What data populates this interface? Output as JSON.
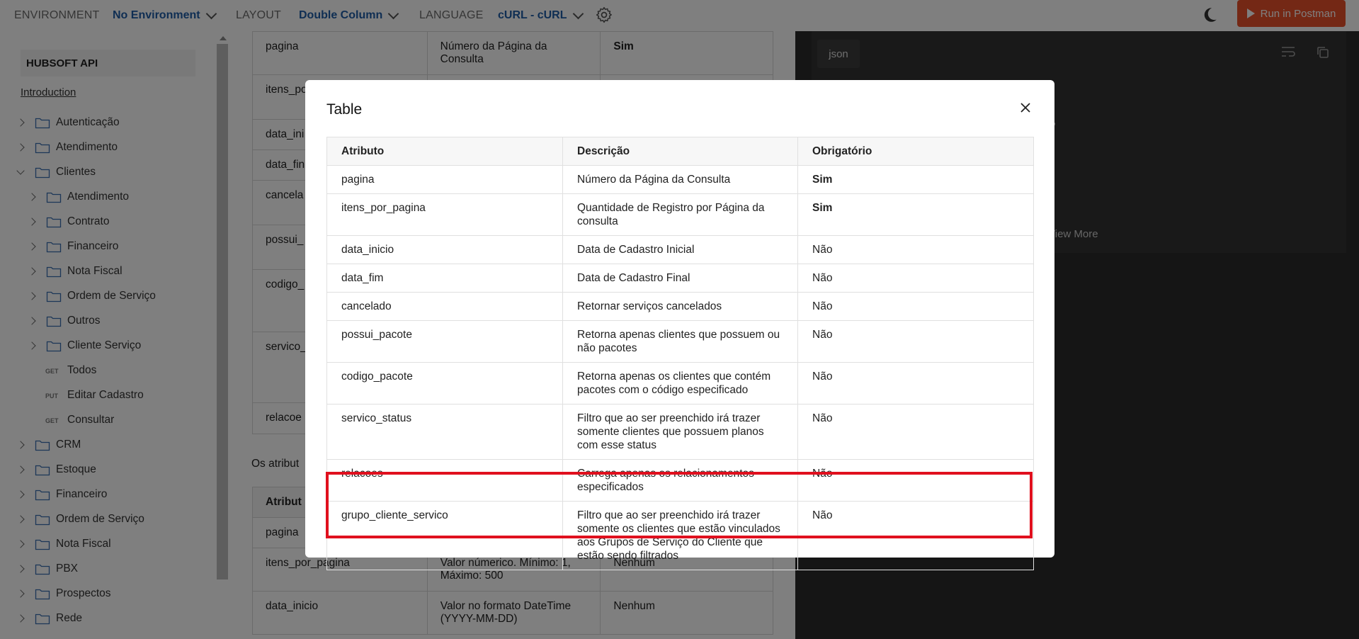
{
  "topbar": {
    "environment_label": "ENVIRONMENT",
    "environment_value": "No Environment",
    "layout_label": "LAYOUT",
    "layout_value": "Double Column",
    "language_label": "LANGUAGE",
    "language_value": "cURL - cURL",
    "run_button": "Run in Postman",
    "accent_color": "#e8502a"
  },
  "sidebar": {
    "title": "HUBSOFT API",
    "intro": "Introduction",
    "items": [
      {
        "label": "Autenticação",
        "type": "folder",
        "level": 0,
        "expanded": false
      },
      {
        "label": "Atendimento",
        "type": "folder",
        "level": 0,
        "expanded": false
      },
      {
        "label": "Clientes",
        "type": "folder",
        "level": 0,
        "expanded": true
      },
      {
        "label": "Atendimento",
        "type": "folder",
        "level": 1,
        "expanded": false
      },
      {
        "label": "Contrato",
        "type": "folder",
        "level": 1,
        "expanded": false
      },
      {
        "label": "Financeiro",
        "type": "folder",
        "level": 1,
        "expanded": false
      },
      {
        "label": "Nota Fiscal",
        "type": "folder",
        "level": 1,
        "expanded": false
      },
      {
        "label": "Ordem de Serviço",
        "type": "folder",
        "level": 1,
        "expanded": false
      },
      {
        "label": "Outros",
        "type": "folder",
        "level": 1,
        "expanded": false
      },
      {
        "label": "Cliente Serviço",
        "type": "folder",
        "level": 1,
        "expanded": false
      },
      {
        "label": "Todos",
        "type": "request",
        "method": "GET",
        "level": 1
      },
      {
        "label": "Editar Cadastro",
        "type": "request",
        "method": "PUT",
        "level": 1
      },
      {
        "label": "Consultar",
        "type": "request",
        "method": "GET",
        "level": 1
      },
      {
        "label": "CRM",
        "type": "folder",
        "level": 0,
        "expanded": false
      },
      {
        "label": "Estoque",
        "type": "folder",
        "level": 0,
        "expanded": false
      },
      {
        "label": "Financeiro",
        "type": "folder",
        "level": 0,
        "expanded": false
      },
      {
        "label": "Ordem de Serviço",
        "type": "folder",
        "level": 0,
        "expanded": false
      },
      {
        "label": "Nota Fiscal",
        "type": "folder",
        "level": 0,
        "expanded": false
      },
      {
        "label": "PBX",
        "type": "folder",
        "level": 0,
        "expanded": false
      },
      {
        "label": "Prospectos",
        "type": "folder",
        "level": 0,
        "expanded": false
      },
      {
        "label": "Rede",
        "type": "folder",
        "level": 0,
        "expanded": false
      }
    ]
  },
  "background": {
    "top_rows": [
      {
        "attr": "pagina",
        "desc": "Número da Página da Consulta",
        "req": "Sim"
      },
      {
        "attr": "itens_po",
        "desc": "",
        "req": ""
      },
      {
        "attr": "data_ini",
        "desc": "",
        "req": ""
      },
      {
        "attr": "data_fin",
        "desc": "",
        "req": ""
      },
      {
        "attr": "cancela",
        "desc": "",
        "req": ""
      },
      {
        "attr": "possui_",
        "desc": "",
        "req": ""
      },
      {
        "attr": "codigo_",
        "desc": "",
        "req": ""
      },
      {
        "attr": "servico_",
        "desc": "",
        "req": ""
      },
      {
        "attr": "relacoe",
        "desc": "",
        "req": ""
      }
    ],
    "caption": "Os atribut",
    "bottom_header": {
      "attr": "Atribut",
      "desc": "",
      "req": ""
    },
    "bottom_rows": [
      {
        "attr": "pagina",
        "desc": "",
        "req": ""
      },
      {
        "attr": "itens_por_pagina",
        "desc": "Valor númerico. Mínimo: 1, Máximo: 500",
        "req": "Nenhum"
      },
      {
        "attr": "data_inicio",
        "desc": "Valor no formato DateTime (YYYY-MM-DD)",
        "req": "Nenhum"
      }
    ]
  },
  "right_panel": {
    "tab": "json",
    "comma": ",",
    "view_more": "View More"
  },
  "modal": {
    "title": "Table",
    "headers": [
      "Atributo",
      "Descrição",
      "Obrigatório"
    ],
    "rows": [
      {
        "attr": "pagina",
        "desc": "Número da Página da Consulta",
        "req": "Sim"
      },
      {
        "attr": "itens_por_pagina",
        "desc": "Quantidade de Registro por Página da consulta",
        "req": "Sim"
      },
      {
        "attr": "data_inicio",
        "desc": "Data de Cadastro Inicial",
        "req": "Não"
      },
      {
        "attr": "data_fim",
        "desc": "Data de Cadastro Final",
        "req": "Não"
      },
      {
        "attr": "cancelado",
        "desc": "Retornar serviços cancelados",
        "req": "Não"
      },
      {
        "attr": "possui_pacote",
        "desc": "Retorna apenas clientes que possuem ou não pacotes",
        "req": "Não"
      },
      {
        "attr": "codigo_pacote",
        "desc": "Retorna apenas os clientes que contém pacotes com o código especificado",
        "req": "Não"
      },
      {
        "attr": "servico_status",
        "desc": "Filtro que ao ser preenchido irá trazer somente clientes que possuem planos com esse status",
        "req": "Não"
      },
      {
        "attr": "relacoes",
        "desc": "Carrega apenas os relacionamentos especificados",
        "req": "Não"
      },
      {
        "attr": "grupo_cliente_servico",
        "desc": "Filtro que ao ser preenchido irá trazer somente os clientes que estão vinculados aos Grupos de Serviço do Cliente que estão sendo filtrados",
        "req": "Não"
      }
    ],
    "highlight_color": "#e0101e"
  }
}
